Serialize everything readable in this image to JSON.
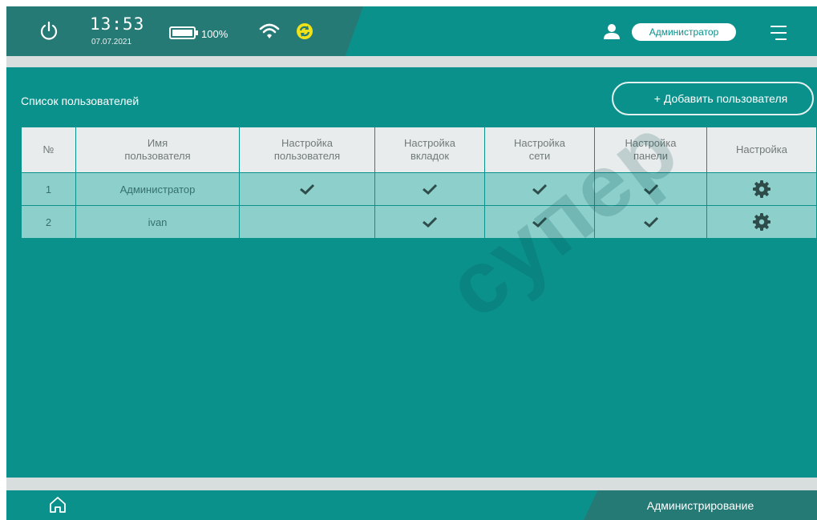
{
  "status_bar": {
    "time": "13:53",
    "date": "07.07.2021",
    "battery": "100%",
    "user_name": "Администратор",
    "icons": [
      "power-icon",
      "battery-icon",
      "wifi-icon",
      "sync-icon",
      "user-icon",
      "menu-icon"
    ]
  },
  "page": {
    "title": "Список пользователей",
    "add_button_label": "+ Добавить пользователя"
  },
  "table": {
    "headers": [
      [
        "№"
      ],
      [
        "Имя",
        "пользователя"
      ],
      [
        "Настройка",
        "пользователя"
      ],
      [
        "Настройка",
        "вкладок"
      ],
      [
        "Настройка",
        "сети"
      ],
      [
        "Настройка",
        "панели"
      ],
      [
        "Настройка"
      ]
    ],
    "rows": [
      {
        "num": "1",
        "name": "Администратор",
        "user_settings": true,
        "tab_settings": true,
        "network_settings": true,
        "panel_settings": true
      },
      {
        "num": "2",
        "name": "ivan",
        "user_settings": false,
        "tab_settings": true,
        "network_settings": true,
        "panel_settings": true
      }
    ]
  },
  "bottom_bar": {
    "section_label": "Администрирование",
    "icons": [
      "home-icon"
    ]
  },
  "watermark": "супер",
  "colors": {
    "background": "#0b918b",
    "dark_panel": "#267a76",
    "row": "#8ccfcb",
    "header": "#e9ecec",
    "sync_accent": "#f0e21a"
  }
}
